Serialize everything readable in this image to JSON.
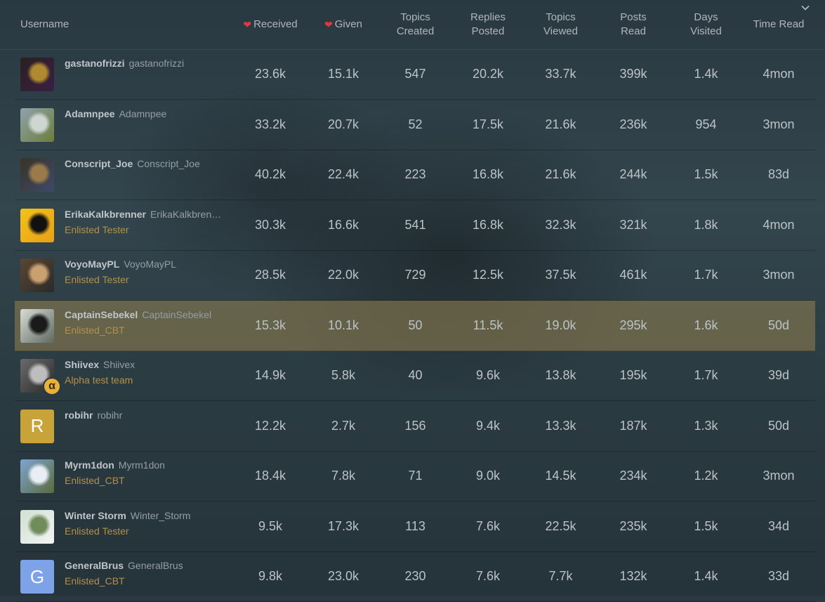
{
  "header": {
    "username": "Username",
    "received": "Received",
    "given": "Given",
    "topics_created": [
      "Topics",
      "Created"
    ],
    "replies_posted": [
      "Replies",
      "Posted"
    ],
    "topics_viewed": [
      "Topics",
      "Viewed"
    ],
    "posts_read": [
      "Posts",
      "Read"
    ],
    "days_visited": [
      "Days",
      "Visited"
    ],
    "time_read": "Time Read"
  },
  "colors": {
    "heart": "#e0383c",
    "title_text": "#b3904a",
    "highlight_row": "#968250"
  },
  "rows": [
    {
      "username": "gastanofrizzi",
      "name": "gastanofrizzi",
      "title": "",
      "received": "23.6k",
      "given": "15.1k",
      "topics": "547",
      "replies": "20.2k",
      "viewed": "33.7k",
      "read": "399k",
      "days": "1.4k",
      "time": "4mon",
      "avatar": {
        "type": "image",
        "colors": [
          "#2a2020",
          "#b08a30",
          "#3a1f44"
        ]
      }
    },
    {
      "username": "Adamnpee",
      "name": "Adamnpee",
      "title": "",
      "received": "33.2k",
      "given": "20.7k",
      "topics": "52",
      "replies": "17.5k",
      "viewed": "21.6k",
      "read": "236k",
      "days": "954",
      "time": "3mon",
      "avatar": {
        "type": "image",
        "colors": [
          "#8fa3ad",
          "#cfd6d2",
          "#6c7d3a"
        ]
      }
    },
    {
      "username": "Conscript_Joe",
      "name": "Conscript_Joe",
      "title": "",
      "received": "40.2k",
      "given": "22.4k",
      "topics": "223",
      "replies": "16.8k",
      "viewed": "21.6k",
      "read": "244k",
      "days": "1.5k",
      "time": "83d",
      "avatar": {
        "type": "image",
        "colors": [
          "#3a3326",
          "#9a7a4a",
          "#3c4a68"
        ]
      }
    },
    {
      "username": "ErikaKalkbrenner",
      "name": "ErikaKalkbren…",
      "title": "Enlisted Tester",
      "received": "30.3k",
      "given": "16.6k",
      "topics": "541",
      "replies": "16.8k",
      "viewed": "32.3k",
      "read": "321k",
      "days": "1.8k",
      "time": "4mon",
      "avatar": {
        "type": "image",
        "colors": [
          "#f2c21a",
          "#111111",
          "#e8a018"
        ]
      }
    },
    {
      "username": "VoyoMayPL",
      "name": "VoyoMayPL",
      "title": "Enlisted Tester",
      "received": "28.5k",
      "given": "22.0k",
      "topics": "729",
      "replies": "12.5k",
      "viewed": "37.5k",
      "read": "461k",
      "days": "1.7k",
      "time": "3mon",
      "avatar": {
        "type": "image",
        "colors": [
          "#5a4632",
          "#c9a070",
          "#2a2a2a"
        ]
      }
    },
    {
      "username": "CaptainSebekel",
      "name": "CaptainSebekel",
      "title": "Enlisted_CBT",
      "received": "15.3k",
      "given": "10.1k",
      "topics": "50",
      "replies": "11.5k",
      "viewed": "19.0k",
      "read": "295k",
      "days": "1.6k",
      "time": "50d",
      "highlight": true,
      "avatar": {
        "type": "image",
        "colors": [
          "#d8dcd8",
          "#1a1a1a",
          "#5e6a5e"
        ]
      }
    },
    {
      "username": "Shiivex",
      "name": "Shiivex",
      "title": "Alpha test team",
      "received": "14.9k",
      "given": "5.8k",
      "topics": "40",
      "replies": "9.6k",
      "viewed": "13.8k",
      "read": "195k",
      "days": "1.7k",
      "time": "39d",
      "avatar": {
        "type": "image",
        "colors": [
          "#6a6a6a",
          "#bdbdbd",
          "#2a2a2a"
        ]
      },
      "badge": "α"
    },
    {
      "username": "robihr",
      "name": "robihr",
      "title": "",
      "received": "12.2k",
      "given": "2.7k",
      "topics": "156",
      "replies": "9.4k",
      "viewed": "13.3k",
      "read": "187k",
      "days": "1.3k",
      "time": "50d",
      "avatar": {
        "type": "letter",
        "letter": "R",
        "bg": "#c8a33a"
      }
    },
    {
      "username": "Myrm1don",
      "name": "Myrm1don",
      "title": "Enlisted_CBT",
      "received": "18.4k",
      "given": "7.8k",
      "topics": "71",
      "replies": "9.0k",
      "viewed": "14.5k",
      "read": "234k",
      "days": "1.2k",
      "time": "3mon",
      "avatar": {
        "type": "image",
        "colors": [
          "#7ea6d4",
          "#e8eef4",
          "#5a6a3a"
        ]
      }
    },
    {
      "username": "Winter Storm",
      "name": "Winter_Storm",
      "title": "Enlisted Tester",
      "received": "9.5k",
      "given": "17.3k",
      "topics": "113",
      "replies": "7.6k",
      "viewed": "22.5k",
      "read": "235k",
      "days": "1.5k",
      "time": "34d",
      "avatar": {
        "type": "image",
        "colors": [
          "#cfe0d0",
          "#6f8c5a",
          "#f4f4f4"
        ]
      }
    },
    {
      "username": "GeneralBrus",
      "name": "GeneralBrus",
      "title": "Enlisted_CBT",
      "received": "9.8k",
      "given": "23.0k",
      "topics": "230",
      "replies": "7.6k",
      "viewed": "7.7k",
      "read": "132k",
      "days": "1.4k",
      "time": "33d",
      "avatar": {
        "type": "letter",
        "letter": "G",
        "bg": "#7ea2e8"
      }
    }
  ]
}
